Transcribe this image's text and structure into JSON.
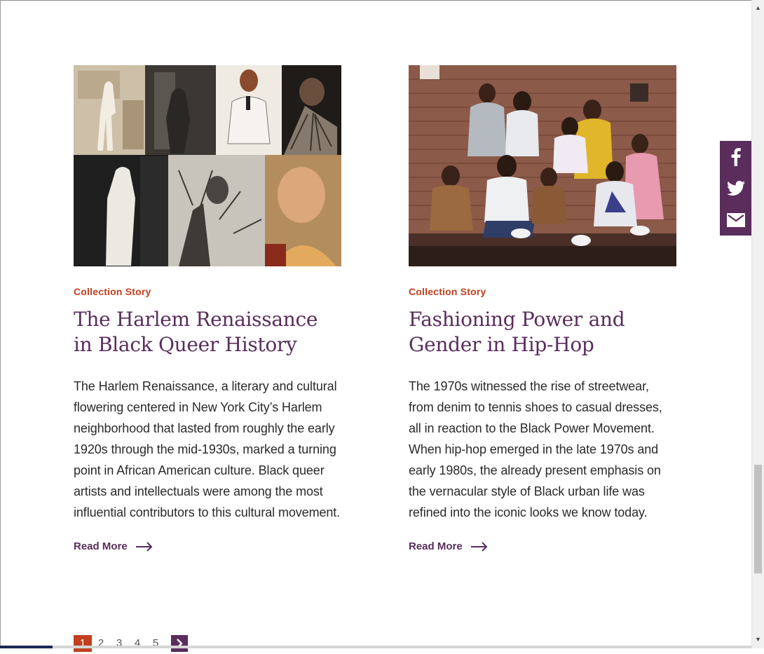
{
  "cards": [
    {
      "eyebrow": "Collection Story",
      "title": "The Harlem Renaissance in Black Queer History",
      "body": "The Harlem Renaissance, a literary and cultural flowering centered in New York City’s Harlem neighborhood that lasted from roughly the early 1920s through the mid-1930s, marked a turning point in African American culture. Black queer artists and intellectuals were among the most influential contributors to this cultural movement.",
      "read_more": "Read More"
    },
    {
      "eyebrow": "Collection Story",
      "title": "Fashioning Power and Gender in Hip-Hop",
      "body": "The 1970s witnessed the rise of streetwear, from denim to tennis shoes to casual dresses, all in reaction to the Black Power Movement. When hip-hop emerged in the late 1970s and early 1980s, the already present emphasis on the vernacular style of Black urban life was refined into the iconic looks we know today.",
      "read_more": "Read More"
    }
  ],
  "share": {
    "items": [
      "facebook-icon",
      "twitter-icon",
      "email-icon"
    ],
    "background": "#5a2d5c"
  },
  "pagination": {
    "pages": [
      "1",
      "2",
      "3",
      "4",
      "5"
    ],
    "current": "1",
    "next_icon": "chevron-right-icon"
  },
  "colors": {
    "accent": "#c1401f",
    "brand": "#5a2d5c"
  }
}
